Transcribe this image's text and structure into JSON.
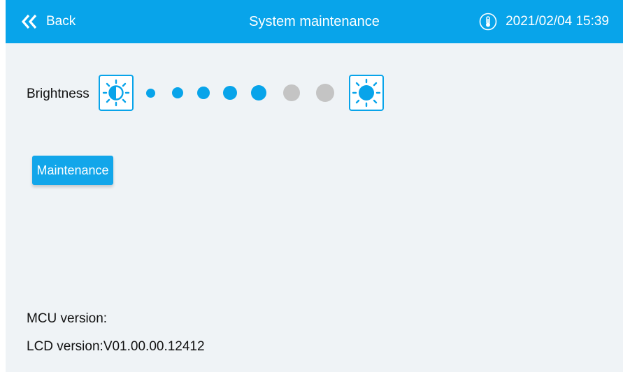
{
  "header": {
    "back_label": "Back",
    "title": "System maintenance",
    "datetime": "2021/02/04  15:39"
  },
  "brightness": {
    "label": "Brightness",
    "level": 5,
    "max_level": 7,
    "active_color": "#08a4ea",
    "inactive_color": "#c4c4c4"
  },
  "maintenance_button": {
    "label": "Maintenance"
  },
  "info": {
    "mcu_version": "MCU version:",
    "lcd_version": "LCD version:V01.00.00.12412"
  },
  "colors": {
    "accent": "#08a4ea",
    "background": "#eff3f6"
  }
}
